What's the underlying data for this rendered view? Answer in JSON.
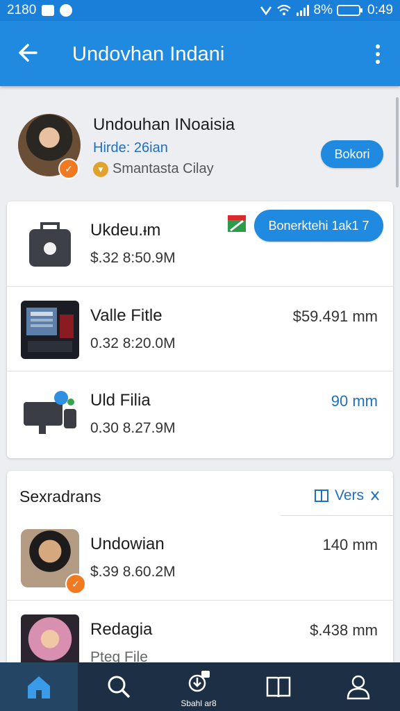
{
  "status_bar": {
    "time_left": "2180",
    "battery": "8%",
    "clock": "0:49"
  },
  "app_bar": {
    "title": "Undovhan Indani",
    "back_icon": "arrow-left-icon",
    "menu_icon": "more-vert-icon"
  },
  "profile": {
    "name": "Undouhan INoaisia",
    "subtitle": "Hirde: 26ian",
    "meta": "Smantasta Cilay",
    "action_label": "Bokori"
  },
  "files": {
    "header_action": "Bonerktehi 1ak1 7",
    "rows": [
      {
        "title": "Ukdeu.ᵻm",
        "detail": "$.32 8:50.9M",
        "value": ""
      },
      {
        "title": "Valle Fitle",
        "detail": "0.32 8:20.0M",
        "value": "$59.491 mm"
      },
      {
        "title": "Uld Filia",
        "detail": "0.30 8.27.9M",
        "value": "90 mm"
      }
    ]
  },
  "section": {
    "label": "Sexradrans",
    "link": "Vers",
    "rows": [
      {
        "title": "Undowian",
        "detail": "$.39 8.60.2M",
        "value": "140 mm"
      },
      {
        "title": "Redagia",
        "detail": "Pteg File",
        "value": "$.438 mm"
      }
    ]
  },
  "bottom_nav": {
    "items": [
      {
        "icon": "home-icon",
        "label": ""
      },
      {
        "icon": "search-icon",
        "label": ""
      },
      {
        "icon": "download-icon",
        "label": "Sbahl ar8"
      },
      {
        "icon": "book-icon",
        "label": ""
      },
      {
        "icon": "profile-icon",
        "label": ""
      }
    ]
  },
  "colors": {
    "primary": "#1f8ae0",
    "status_bar": "#1a7fd8",
    "nav_bg": "#1c2f44",
    "nav_active": "#244563",
    "accent_orange": "#f07a22",
    "link_blue": "#1f6fc0"
  }
}
